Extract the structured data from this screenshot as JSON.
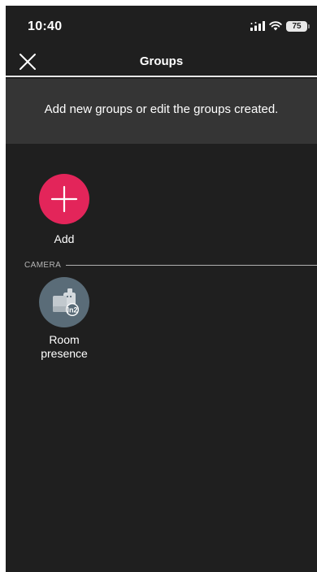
{
  "status_bar": {
    "time": "10:40",
    "battery": "75",
    "icons": [
      "signal-icon",
      "wifi-icon",
      "battery-icon"
    ]
  },
  "nav": {
    "title": "Groups",
    "close_icon": "close-icon"
  },
  "banner": {
    "text": "Add new groups or edit the groups created."
  },
  "add_tile": {
    "label": "Add",
    "icon": "plus-icon",
    "color": "#e3255a"
  },
  "sections": [
    {
      "title": "CAMERA",
      "groups": [
        {
          "label": "Room presence",
          "icon": "camera-device-icon",
          "badge": "In2",
          "color": "#5a6c78"
        }
      ]
    }
  ],
  "colors": {
    "background": "#1f1f1f",
    "banner": "#353535",
    "accent": "#e3255a"
  }
}
